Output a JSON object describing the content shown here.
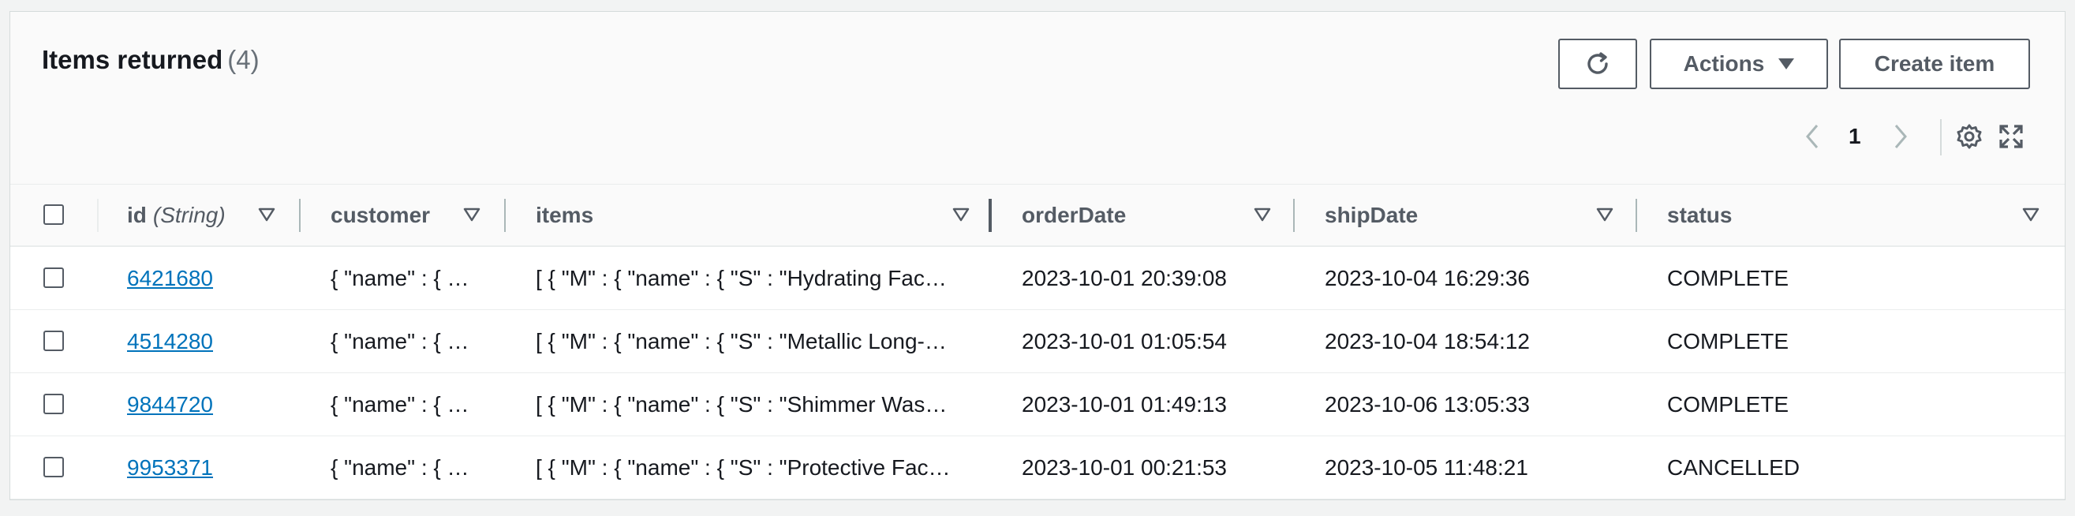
{
  "header": {
    "title": "Items returned",
    "count": "(4)",
    "actions_label": "Actions",
    "create_label": "Create item",
    "refresh_icon": "refresh-icon",
    "page_number": "1"
  },
  "table": {
    "columns": [
      {
        "label": "id",
        "type": "(String)"
      },
      {
        "label": "customer"
      },
      {
        "label": "items"
      },
      {
        "label": "orderDate"
      },
      {
        "label": "shipDate"
      },
      {
        "label": "status"
      }
    ],
    "rows": [
      {
        "id": "6421680",
        "customer": "{ \"name\" : { …",
        "items": "[ { \"M\" : { \"name\" : { \"S\" : \"Hydrating Fac…",
        "orderDate": "2023-10-01 20:39:08",
        "shipDate": "2023-10-04 16:29:36",
        "status": "COMPLETE"
      },
      {
        "id": "4514280",
        "customer": "{ \"name\" : { …",
        "items": "[ { \"M\" : { \"name\" : { \"S\" : \"Metallic Long-…",
        "orderDate": "2023-10-01 01:05:54",
        "shipDate": "2023-10-04 18:54:12",
        "status": "COMPLETE"
      },
      {
        "id": "9844720",
        "customer": "{ \"name\" : { …",
        "items": "[ { \"M\" : { \"name\" : { \"S\" : \"Shimmer Was…",
        "orderDate": "2023-10-01 01:49:13",
        "shipDate": "2023-10-06 13:05:33",
        "status": "COMPLETE"
      },
      {
        "id": "9953371",
        "customer": "{ \"name\" : { …",
        "items": "[ { \"M\" : { \"name\" : { \"S\" : \"Protective Fac…",
        "orderDate": "2023-10-01 00:21:53",
        "shipDate": "2023-10-05 11:48:21",
        "status": "CANCELLED"
      }
    ]
  },
  "colors": {
    "link": "#0073bb",
    "border": "#545b64",
    "muted": "#687078"
  }
}
